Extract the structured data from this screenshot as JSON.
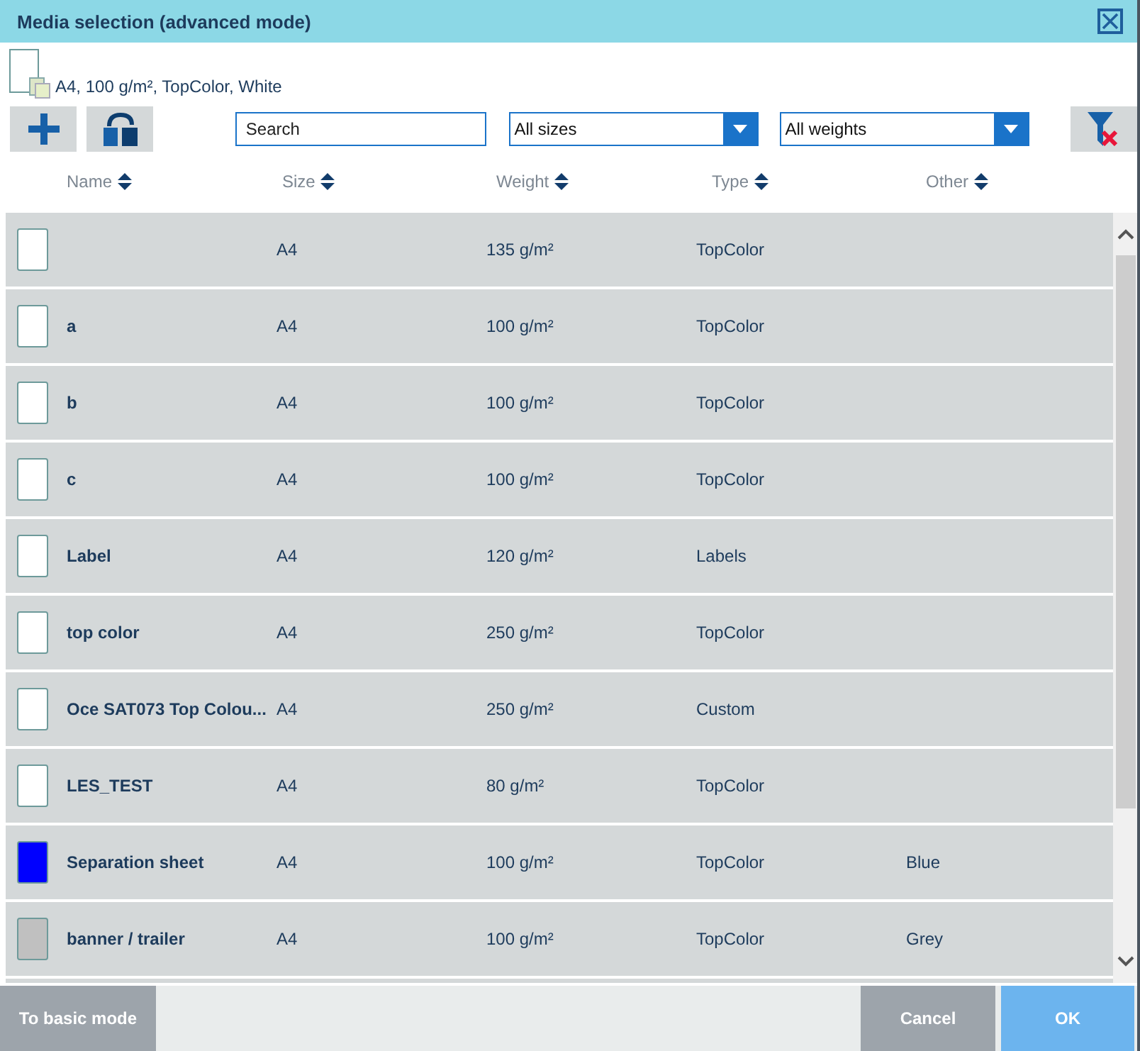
{
  "window": {
    "title": "Media selection (advanced mode)"
  },
  "current_media": "A4, 100 g/m², TopColor, White",
  "search": {
    "placeholder": "Search"
  },
  "size_filter": {
    "value": "All sizes"
  },
  "weight_filter": {
    "value": "All weights"
  },
  "columns": [
    "Name",
    "Size",
    "Weight",
    "Type",
    "Other"
  ],
  "rows": [
    {
      "name": "",
      "size": "A4",
      "weight": "135 g/m²",
      "type": "TopColor",
      "other": "",
      "color": "#ffffff"
    },
    {
      "name": "a",
      "size": "A4",
      "weight": "100 g/m²",
      "type": "TopColor",
      "other": "",
      "color": "#ffffff"
    },
    {
      "name": "b",
      "size": "A4",
      "weight": "100 g/m²",
      "type": "TopColor",
      "other": "",
      "color": "#ffffff"
    },
    {
      "name": "c",
      "size": "A4",
      "weight": "100 g/m²",
      "type": "TopColor",
      "other": "",
      "color": "#ffffff"
    },
    {
      "name": "Label",
      "size": "A4",
      "weight": "120 g/m²",
      "type": "Labels",
      "other": "",
      "color": "#ffffff"
    },
    {
      "name": "top color",
      "size": "A4",
      "weight": "250 g/m²",
      "type": "TopColor",
      "other": "",
      "color": "#ffffff"
    },
    {
      "name": "Oce SAT073 Top Colou...",
      "size": "A4",
      "weight": "250 g/m²",
      "type": "Custom",
      "other": "",
      "color": "#ffffff"
    },
    {
      "name": "LES_TEST",
      "size": "A4",
      "weight": "80 g/m²",
      "type": "TopColor",
      "other": "",
      "color": "#ffffff"
    },
    {
      "name": "Separation sheet",
      "size": "A4",
      "weight": "100 g/m²",
      "type": "TopColor",
      "other": "Blue",
      "color": "#0000ff"
    },
    {
      "name": "banner / trailer",
      "size": "A4",
      "weight": "100 g/m²",
      "type": "TopColor",
      "other": "Grey",
      "color": "#c0c0c0"
    }
  ],
  "footer_buttons": {
    "basic": "To basic mode",
    "cancel": "Cancel",
    "ok": "OK"
  }
}
